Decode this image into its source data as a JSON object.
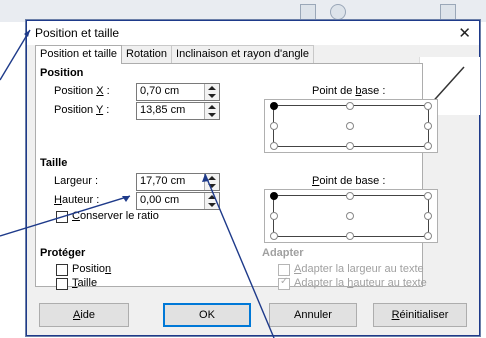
{
  "dialog": {
    "title": "Position et taille",
    "close_glyph": "✕"
  },
  "tabs": [
    {
      "label": "Position et taille",
      "active": true
    },
    {
      "label": "Rotation",
      "active": false
    },
    {
      "label": "Inclinaison et rayon d'angle",
      "active": false
    }
  ],
  "position": {
    "heading": "Position",
    "x_label_pre": "Position ",
    "x_label_key": "X",
    "x_label_post": " :",
    "x_value": "0,70 cm",
    "y_label_pre": "Position ",
    "y_label_key": "Y",
    "y_label_post": " :",
    "y_value": "13,85 cm",
    "base_label_pre": "Point de ",
    "base_label_key": "b",
    "base_label_post": "ase :"
  },
  "size": {
    "heading": "Taille",
    "width_label_pre": "Lar",
    "width_label_key": "g",
    "width_label_post": "eur :",
    "width_value": "17,70 cm",
    "height_label_key": "H",
    "height_label_post": "auteur :",
    "height_value": "0,00 cm",
    "keep_ratio_key": "C",
    "keep_ratio_post": "onserver le ratio",
    "base_label_key": "P",
    "base_label_post": "oint de base :"
  },
  "protect": {
    "heading": "Protéger",
    "position_pre": "Positio",
    "position_key": "n",
    "size_key": "T",
    "size_post": "aille"
  },
  "adapt": {
    "heading": "Adapter",
    "fit_width_key": "A",
    "fit_width_post": "dapter la largeur au texte",
    "fit_height_pre": "Adapter la ",
    "fit_height_key": "h",
    "fit_height_post": "auteur au texte",
    "fit_height_checked_glyph": "✓"
  },
  "buttons": {
    "help_key": "A",
    "help_post": "ide",
    "ok": "OK",
    "cancel": "Annuler",
    "reset_key": "R",
    "reset_post": "éinitialiser"
  }
}
